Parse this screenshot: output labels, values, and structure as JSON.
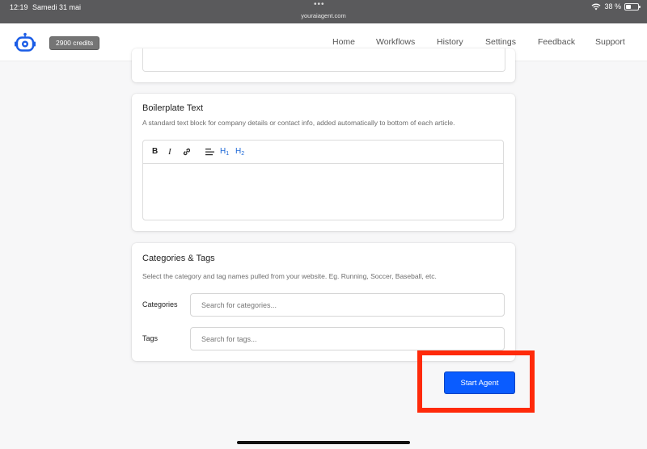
{
  "status_bar": {
    "time": "12:19",
    "date": "Samedi 31 mai",
    "url": "youraiagent.com",
    "battery": "38 %",
    "dots": "•••"
  },
  "nav": {
    "credits": "2900 credits",
    "links": [
      "Home",
      "Workflows",
      "History",
      "Settings",
      "Feedback",
      "Support"
    ]
  },
  "boilerplate": {
    "title": "Boilerplate Text",
    "description": "A standard text block for company details or contact info, added automatically to bottom of each article.",
    "toolbar": {
      "bold": "B",
      "italic": "I",
      "h1": "H",
      "h1_sub": "1",
      "h2": "H",
      "h2_sub": "2"
    }
  },
  "categories_tags": {
    "title": "Categories & Tags",
    "description": "Select the category and tag names pulled from your website. Eg. Running, Soccer, Baseball, etc.",
    "categories_label": "Categories",
    "categories_placeholder": "Search for categories...",
    "tags_label": "Tags",
    "tags_placeholder": "Search for tags..."
  },
  "actions": {
    "start_label": "Start Agent"
  },
  "colors": {
    "primary": "#0a5cff",
    "highlight": "#ff2a0a",
    "heading_accent": "#1a66d6",
    "logo": "#1a5ce6"
  }
}
